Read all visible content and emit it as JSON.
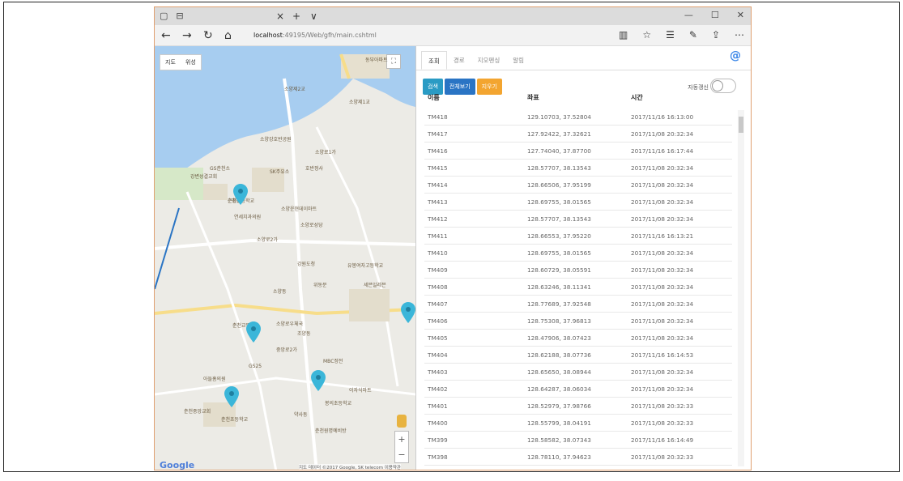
{
  "browser": {
    "url_host": "localhost",
    "url_path": ":49195/Web/gfh/main.cshtml",
    "new_tab": "+",
    "close_tab": "×",
    "tab_menu": "∨"
  },
  "map": {
    "type_buttons": [
      "지도",
      "위성"
    ],
    "google": "Google",
    "attribution": "지도 데이터 ©2017 Google, SK telecom   이용약관",
    "zoom_in": "+",
    "zoom_out": "−",
    "labels": [
      "소양제2교",
      "소양제1교",
      "소양강호반공원",
      "소양로1가",
      "GS춘천소",
      "강변성결교회",
      "SK주유소",
      "호반정사",
      "춘천초등학교",
      "소양로2가",
      "소양로성당",
      "연세치과의원",
      "소양운현데이마트",
      "강원도청",
      "위동문",
      "세븐일레븐",
      "유봉여자고등학교",
      "소양동",
      "춘천교동",
      "소양로우체국",
      "조양동",
      "GS25",
      "MBC정전",
      "아들흠의원",
      "춘천초등학교",
      "봉의초등학교",
      "이자식마트",
      "약사동",
      "춘천원명예비방",
      "중앙로2가",
      "춘천중앙교회",
      "동부아파트",
      "근화동"
    ]
  },
  "panel": {
    "tabs": [
      "조회",
      "경로",
      "지오펜싱",
      "알림"
    ],
    "at_icon": "@",
    "buttons": {
      "search": "검색",
      "view_all": "전체보기",
      "clear": "지우기"
    },
    "auto_refresh_label": "자동갱신",
    "columns": {
      "name": "이름",
      "coord": "좌표",
      "time": "시간"
    },
    "rows": [
      {
        "name": "TM418",
        "coord": "129.10703, 37.52804",
        "time": "2017/11/16 16:13:00"
      },
      {
        "name": "TM417",
        "coord": "127.92422, 37.32621",
        "time": "2017/11/08 20:32:34"
      },
      {
        "name": "TM416",
        "coord": "127.74040, 37.87700",
        "time": "2017/11/16 16:17:44"
      },
      {
        "name": "TM415",
        "coord": "128.57707, 38.13543",
        "time": "2017/11/08 20:32:34"
      },
      {
        "name": "TM414",
        "coord": "128.66506, 37.95199",
        "time": "2017/11/08 20:32:34"
      },
      {
        "name": "TM413",
        "coord": "128.69755, 38.01565",
        "time": "2017/11/08 20:32:34"
      },
      {
        "name": "TM412",
        "coord": "128.57707, 38.13543",
        "time": "2017/11/08 20:32:34"
      },
      {
        "name": "TM411",
        "coord": "128.66553, 37.95220",
        "time": "2017/11/16 16:13:21"
      },
      {
        "name": "TM410",
        "coord": "128.69755, 38.01565",
        "time": "2017/11/08 20:32:34"
      },
      {
        "name": "TM409",
        "coord": "128.60729, 38.05591",
        "time": "2017/11/08 20:32:34"
      },
      {
        "name": "TM408",
        "coord": "128.63246, 38.11341",
        "time": "2017/11/08 20:32:34"
      },
      {
        "name": "TM407",
        "coord": "128.77689, 37.92548",
        "time": "2017/11/08 20:32:34"
      },
      {
        "name": "TM406",
        "coord": "128.75308, 37.96813",
        "time": "2017/11/08 20:32:34"
      },
      {
        "name": "TM405",
        "coord": "128.47906, 38.07423",
        "time": "2017/11/08 20:32:34"
      },
      {
        "name": "TM404",
        "coord": "128.62188, 38.07736",
        "time": "2017/11/16 16:14:53"
      },
      {
        "name": "TM403",
        "coord": "128.65650, 38.08944",
        "time": "2017/11/08 20:32:34"
      },
      {
        "name": "TM402",
        "coord": "128.64287, 38.06034",
        "time": "2017/11/08 20:32:34"
      },
      {
        "name": "TM401",
        "coord": "128.52979, 37.98766",
        "time": "2017/11/08 20:32:33"
      },
      {
        "name": "TM400",
        "coord": "128.55799, 38.04191",
        "time": "2017/11/08 20:32:33"
      },
      {
        "name": "TM399",
        "coord": "128.58582, 38.07343",
        "time": "2017/11/16 16:14:49"
      },
      {
        "name": "TM398",
        "coord": "128.78110, 37.94623",
        "time": "2017/11/08 20:32:33"
      }
    ]
  },
  "colors": {
    "accent": "#2a9bc4",
    "view_all": "#2a74c4",
    "clear": "#f3a530",
    "pin": "#3bb6d9",
    "water": "#a7cdf0",
    "frame": "#e0a070"
  },
  "icons": {
    "back": "arrow-left-icon",
    "forward": "arrow-right-icon",
    "refresh": "refresh-icon",
    "home": "home-icon",
    "reading": "reading-view-icon",
    "favorite": "star-icon",
    "hub": "hub-icon",
    "notes": "pen-icon",
    "share": "share-icon",
    "more": "more-icon",
    "map_pin": "map-pin-icon",
    "pegman": "pegman-icon",
    "fullscreen": "fullscreen-icon"
  }
}
